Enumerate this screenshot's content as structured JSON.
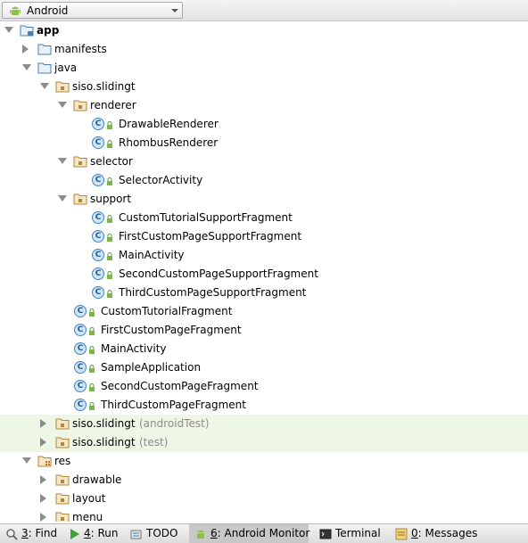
{
  "view_selector": {
    "value": "Android"
  },
  "tree": [
    {
      "label": "app",
      "bold": true,
      "kind": "module",
      "arrow": "exp",
      "depth": 0
    },
    {
      "label": "manifests",
      "kind": "folder-blue",
      "arrow": "col",
      "depth": 1
    },
    {
      "label": "java",
      "kind": "folder-blue",
      "arrow": "exp",
      "depth": 1
    },
    {
      "label": "siso.slidingt",
      "kind": "package",
      "arrow": "exp",
      "depth": 2
    },
    {
      "label": "renderer",
      "kind": "package",
      "arrow": "exp",
      "depth": 3
    },
    {
      "label": "DrawableRenderer",
      "kind": "class",
      "depth": 5
    },
    {
      "label": "RhombusRenderer",
      "kind": "class",
      "depth": 5
    },
    {
      "label": "selector",
      "kind": "package",
      "arrow": "exp",
      "depth": 3
    },
    {
      "label": "SelectorActivity",
      "kind": "class",
      "depth": 5
    },
    {
      "label": "support",
      "kind": "package",
      "arrow": "exp",
      "depth": 3
    },
    {
      "label": "CustomTutorialSupportFragment",
      "kind": "class",
      "depth": 5
    },
    {
      "label": "FirstCustomPageSupportFragment",
      "kind": "class",
      "depth": 5
    },
    {
      "label": "MainActivity",
      "kind": "class",
      "depth": 5
    },
    {
      "label": "SecondCustomPageSupportFragment",
      "kind": "class",
      "depth": 5
    },
    {
      "label": "ThirdCustomPageSupportFragment",
      "kind": "class",
      "depth": 5
    },
    {
      "label": "CustomTutorialFragment",
      "kind": "class",
      "depth": 4
    },
    {
      "label": "FirstCustomPageFragment",
      "kind": "class",
      "depth": 4
    },
    {
      "label": "MainActivity",
      "kind": "class",
      "depth": 4
    },
    {
      "label": "SampleApplication",
      "kind": "class",
      "depth": 4
    },
    {
      "label": "SecondCustomPageFragment",
      "kind": "class",
      "depth": 4
    },
    {
      "label": "ThirdCustomPageFragment",
      "kind": "class",
      "depth": 4
    },
    {
      "label": "siso.slidingt",
      "suffix": "(androidTest)",
      "kind": "package",
      "arrow": "col",
      "depth": 2,
      "highlight": true
    },
    {
      "label": "siso.slidingt",
      "suffix": "(test)",
      "kind": "package",
      "arrow": "col",
      "depth": 2,
      "highlight": true
    },
    {
      "label": "res",
      "kind": "res",
      "arrow": "exp",
      "depth": 1
    },
    {
      "label": "drawable",
      "kind": "package",
      "arrow": "col",
      "depth": 2
    },
    {
      "label": "layout",
      "kind": "package",
      "arrow": "col",
      "depth": 2
    },
    {
      "label": "menu",
      "kind": "package",
      "arrow": "col",
      "depth": 2
    }
  ],
  "bottom_tabs": [
    {
      "key": "3",
      "label": ": Find",
      "icon": "search-icon",
      "active": false
    },
    {
      "key": "4",
      "label": ": Run",
      "icon": "run-icon",
      "active": false
    },
    {
      "key": "",
      "label": "TODO",
      "icon": "todo-icon",
      "active": false
    },
    {
      "key": "6",
      "label": ": Android Monitor",
      "icon": "android-icon",
      "active": true
    },
    {
      "key": "",
      "label": "Terminal",
      "icon": "terminal-icon",
      "active": false
    },
    {
      "key": "0",
      "label": ": Messages",
      "icon": "messages-icon",
      "active": false
    }
  ],
  "colors": {
    "highlight_row": "#eef6e5",
    "class_icon": "#3f86c6",
    "android_green": "#8cc04b"
  }
}
